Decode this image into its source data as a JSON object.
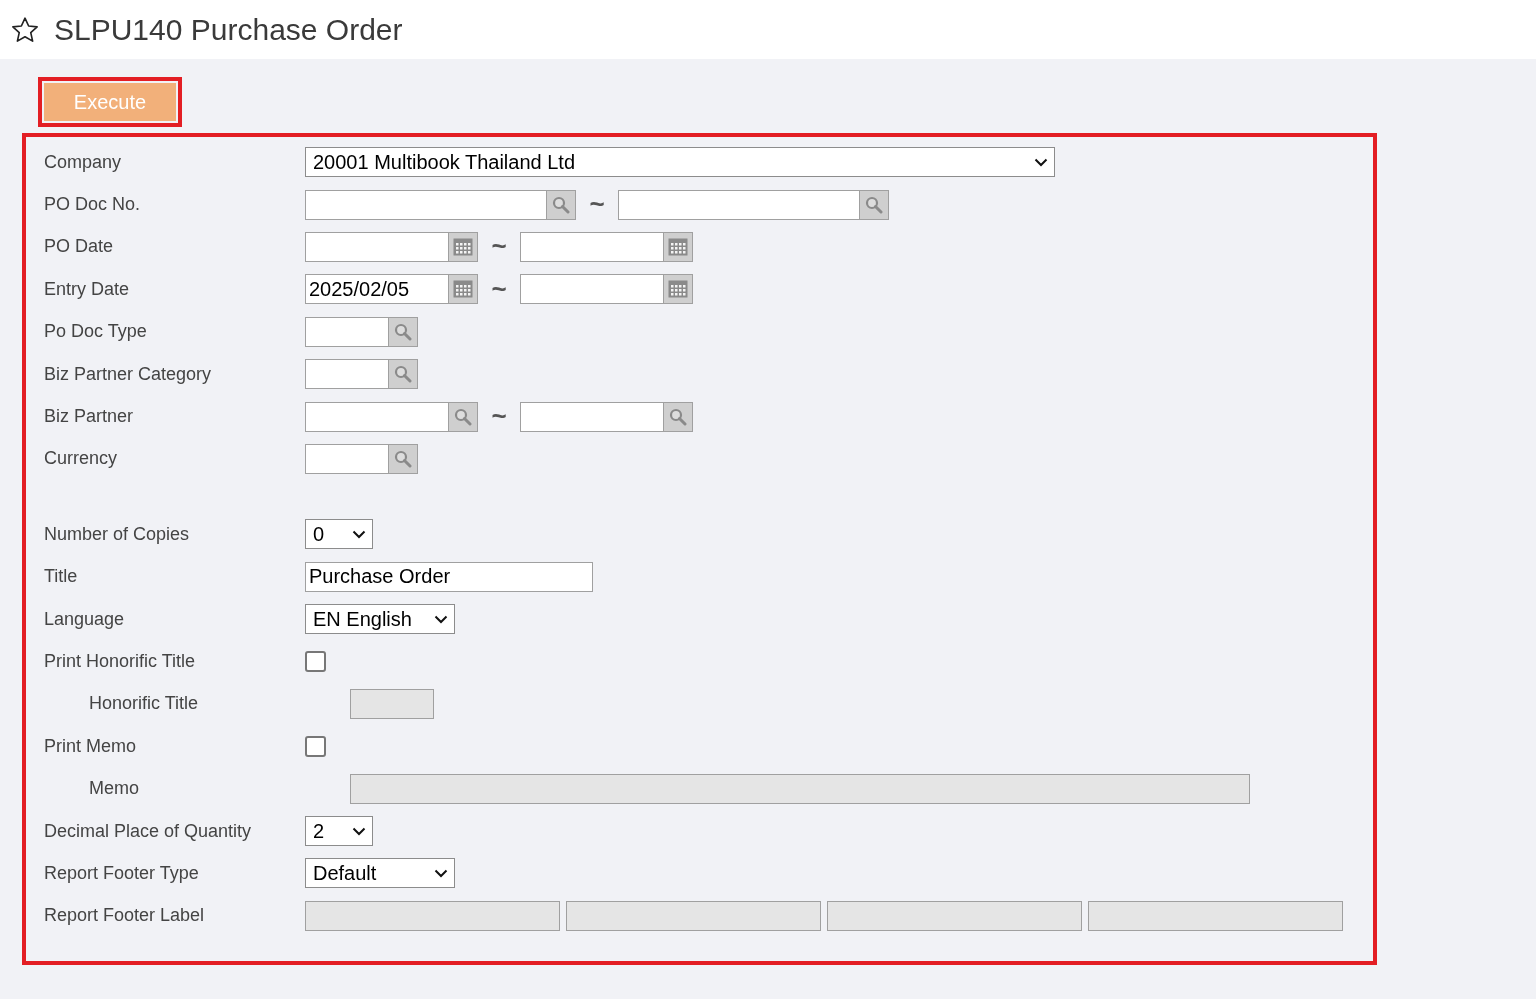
{
  "page": {
    "title": "SLPU140 Purchase Order",
    "favorite": false
  },
  "execute_button": {
    "label": "Execute"
  },
  "criteria": [
    {
      "label": "Company",
      "kind": "wide-select",
      "value": "20001 Multibook Thailand Ltd"
    },
    {
      "label": "PO Doc No.",
      "kind": "wide-lookup-range",
      "separator": "~"
    },
    {
      "label": "PO Date",
      "kind": "date-range",
      "separator": "~"
    },
    {
      "label": "Entry Date",
      "kind": "date-range",
      "from": "2025/02/05",
      "separator": "~"
    },
    {
      "label": "Po Doc Type",
      "kind": "lookup"
    },
    {
      "label": "Biz Partner Category",
      "kind": "lookup"
    },
    {
      "label": "Biz Partner",
      "kind": "lookup-range",
      "separator": "~"
    },
    {
      "label": "Currency",
      "kind": "lookup"
    }
  ],
  "options": [
    {
      "label": "Number of Copies",
      "kind": "short-select",
      "value": "0"
    },
    {
      "label": "Title",
      "kind": "text",
      "value": "Purchase Order"
    },
    {
      "label": "Language",
      "kind": "select",
      "value": "EN English"
    },
    {
      "label": "Print Honorific Title",
      "kind": "checkbox",
      "checked": false
    },
    {
      "label": "Honorific Title",
      "kind": "short-disabled",
      "indented": true
    },
    {
      "label": "Print Memo",
      "kind": "checkbox",
      "checked": false
    },
    {
      "label": "Memo",
      "kind": "wide-disabled",
      "indented": true
    },
    {
      "label": "Decimal Place of Quantity",
      "kind": "short-select",
      "value": "2"
    },
    {
      "label": "Report Footer Type",
      "kind": "select",
      "value": "Default"
    },
    {
      "label": "Report Footer Label",
      "kind": "footer-fields"
    }
  ]
}
